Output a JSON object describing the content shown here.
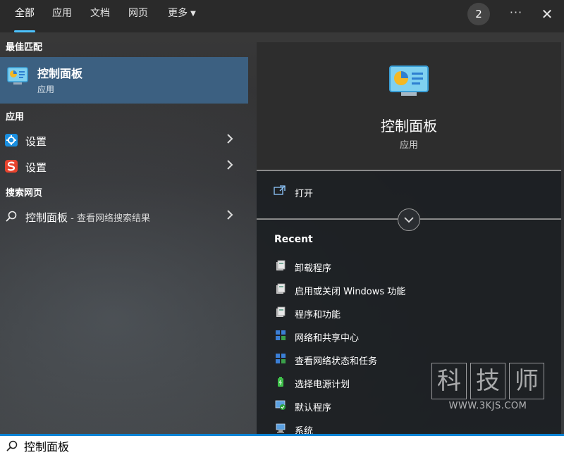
{
  "tabs": [
    {
      "label": "全部",
      "active": true
    },
    {
      "label": "应用",
      "active": false
    },
    {
      "label": "文档",
      "active": false
    },
    {
      "label": "网页",
      "active": false
    },
    {
      "label": "更多",
      "active": false
    }
  ],
  "header": {
    "badge_count": "2",
    "more_label": "···",
    "close_label": "✕"
  },
  "left": {
    "best_match_header": "最佳匹配",
    "best_match": {
      "title": "控制面板",
      "subtitle": "应用",
      "icon": "control-panel-icon"
    },
    "apps_header": "应用",
    "apps": [
      {
        "label": "设置",
        "icon": "gear-icon",
        "icon_color": "#1a8fe0"
      },
      {
        "label": "设置",
        "icon": "sogou-s-icon",
        "icon_color": "#e8432d"
      }
    ],
    "web_header": "搜索网页",
    "web": {
      "query": "控制面板",
      "suffix": " - 查看网络搜索结果",
      "icon": "search-icon"
    }
  },
  "right": {
    "app_name": "控制面板",
    "app_kind": "应用",
    "open_label": "打开",
    "recent_title": "Recent",
    "recent": [
      {
        "label": "卸载程序",
        "icon": "programs-icon"
      },
      {
        "label": "启用或关闭 Windows 功能",
        "icon": "programs-icon"
      },
      {
        "label": "程序和功能",
        "icon": "programs-icon"
      },
      {
        "label": "网络和共享中心",
        "icon": "network-icon"
      },
      {
        "label": "查看网络状态和任务",
        "icon": "network-icon"
      },
      {
        "label": "选择电源计划",
        "icon": "power-icon"
      },
      {
        "label": "默认程序",
        "icon": "default-programs-icon"
      },
      {
        "label": "系统",
        "icon": "system-icon"
      }
    ]
  },
  "watermark": {
    "chars": [
      "科",
      "技",
      "师"
    ],
    "url": "WWW.3KJS.COM"
  },
  "search": {
    "value": "控制面板"
  },
  "colors": {
    "accent": "#4cc2ff",
    "selected_row": "#3c6081",
    "search_border": "#0a84d6"
  }
}
